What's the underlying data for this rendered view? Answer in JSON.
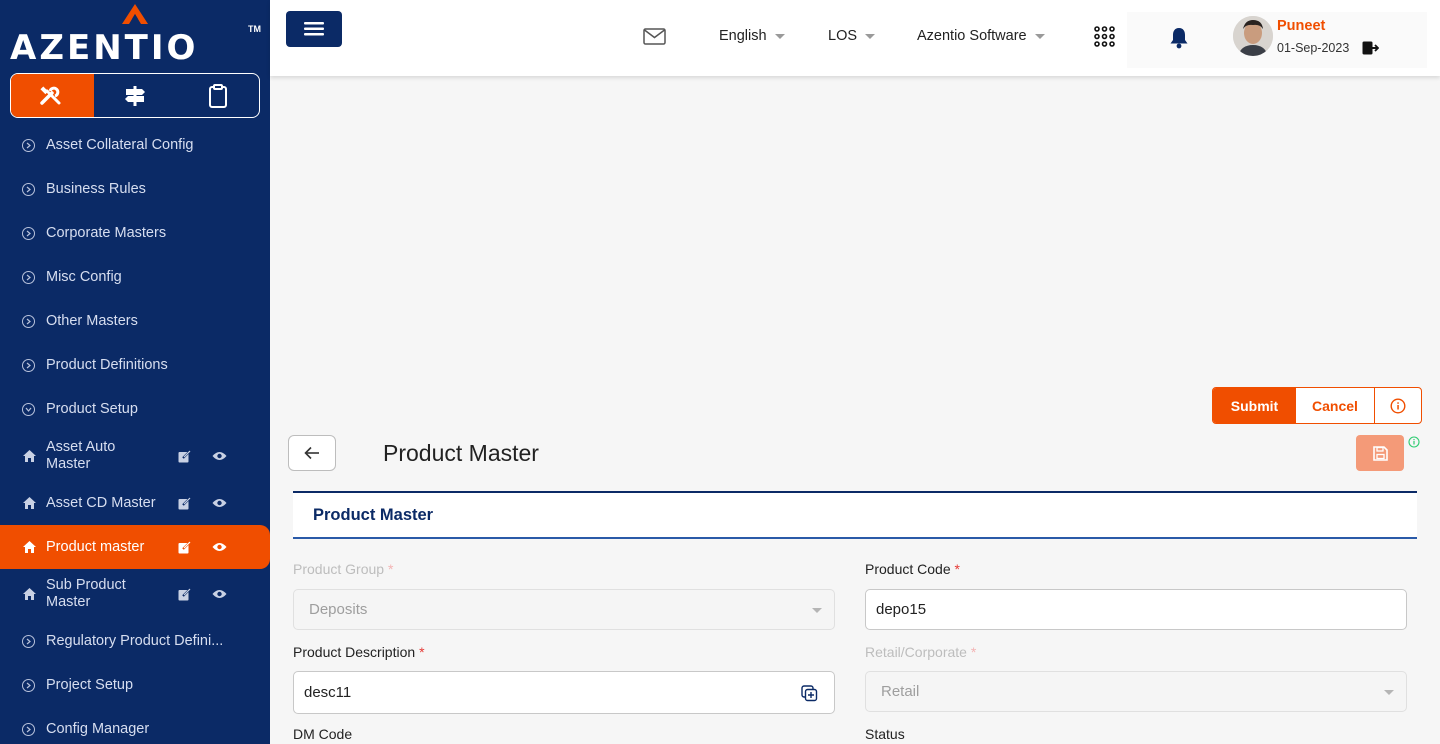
{
  "brand": {
    "name": "AZENTIO",
    "tm": "TM"
  },
  "sidebar": {
    "items": [
      {
        "label": "Asset Collateral Config"
      },
      {
        "label": "Business Rules"
      },
      {
        "label": "Corporate Masters"
      },
      {
        "label": "Misc Config"
      },
      {
        "label": "Other Masters"
      },
      {
        "label": "Product Definitions"
      },
      {
        "label": "Product Setup"
      },
      {
        "label": "Asset Auto Master"
      },
      {
        "label": "Asset CD Master"
      },
      {
        "label": "Product master"
      },
      {
        "label": "Sub Product Master"
      },
      {
        "label": "Regulatory Product Defini..."
      },
      {
        "label": "Project Setup"
      },
      {
        "label": "Config Manager"
      }
    ]
  },
  "header": {
    "language": "English",
    "module": "LOS",
    "company": "Azentio Software",
    "user": {
      "name": "Puneet",
      "date": "01-Sep-2023"
    }
  },
  "actions": {
    "submit": "Submit",
    "cancel": "Cancel"
  },
  "page": {
    "title": "Product Master",
    "section": "Product Master"
  },
  "form": {
    "product_group": {
      "label": "Product Group",
      "req": "*",
      "value": "Deposits"
    },
    "product_code": {
      "label": "Product Code",
      "req": "*",
      "value": "depo15"
    },
    "product_description": {
      "label": "Product Description",
      "req": "*",
      "value": "desc11"
    },
    "retail_corporate": {
      "label": "Retail/Corporate",
      "req": "*",
      "value": "Retail"
    },
    "dm_code": {
      "label": "DM Code"
    },
    "status": {
      "label": "Status"
    }
  },
  "colors": {
    "navy": "#0b2a66",
    "accent": "#f04e00"
  }
}
